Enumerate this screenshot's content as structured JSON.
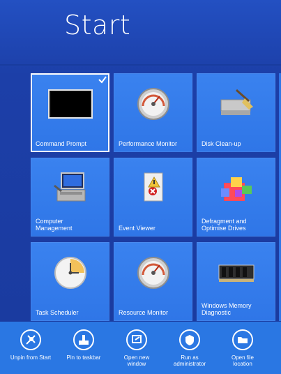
{
  "page": {
    "title": "Start"
  },
  "tiles": [
    {
      "label": "Command Prompt",
      "selected": true,
      "icon": "cmd-icon"
    },
    {
      "label": "Performance Monitor",
      "selected": false,
      "icon": "gauge-icon"
    },
    {
      "label": "Disk Clean-up",
      "selected": false,
      "icon": "disk-cleanup-icon"
    },
    {
      "label": "Computer\nManagement",
      "selected": false,
      "icon": "computer-management-icon"
    },
    {
      "label": "Event Viewer",
      "selected": false,
      "icon": "event-viewer-icon"
    },
    {
      "label": "Defragment and\nOptimise Drives",
      "selected": false,
      "icon": "defrag-icon"
    },
    {
      "label": "Task Scheduler",
      "selected": false,
      "icon": "clock-icon"
    },
    {
      "label": "Resource Monitor",
      "selected": false,
      "icon": "gauge-icon"
    },
    {
      "label": "Windows Memory\nDiagnostic",
      "selected": false,
      "icon": "memory-chip-icon"
    }
  ],
  "appbar": {
    "commands": [
      {
        "label": "Unpin from Start",
        "icon": "unpin-icon"
      },
      {
        "label": "Pin to taskbar",
        "icon": "pin-taskbar-icon"
      },
      {
        "label": "Open new\nwindow",
        "icon": "open-window-icon"
      },
      {
        "label": "Run as\nadministrator",
        "icon": "shield-icon"
      },
      {
        "label": "Open file\nlocation",
        "icon": "folder-icon"
      }
    ]
  },
  "colors": {
    "background": "#1d3ea8",
    "tile": "#2f76e7",
    "appbar": "#2a77e3"
  }
}
